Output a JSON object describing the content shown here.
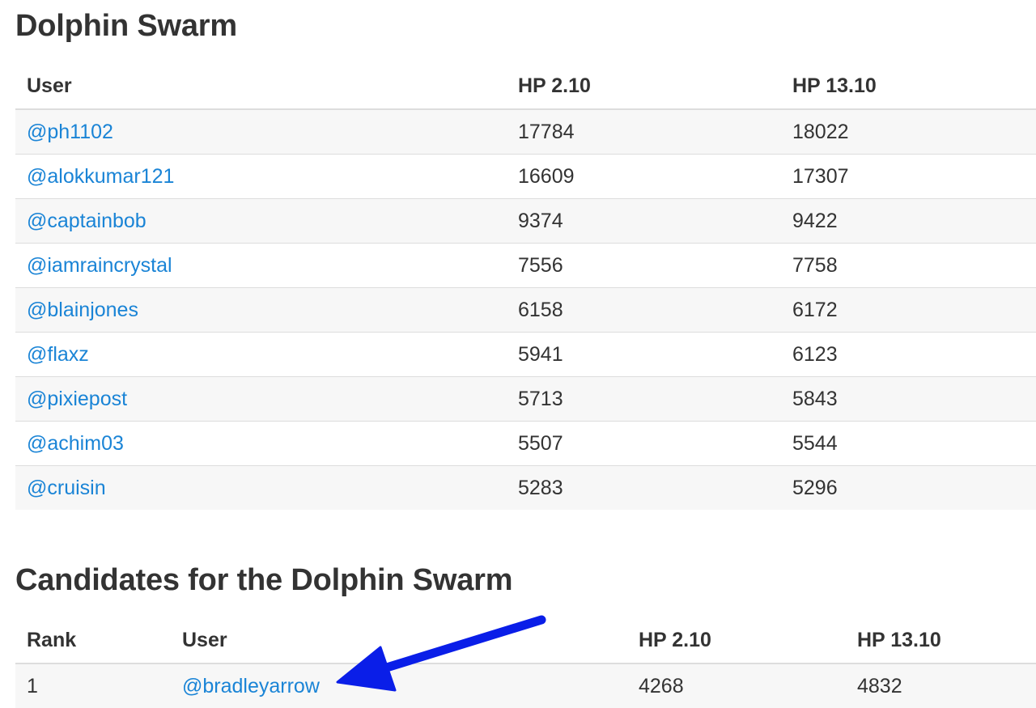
{
  "swarm": {
    "title": "Dolphin Swarm",
    "headers": [
      "User",
      "HP 2.10",
      "HP 13.10"
    ],
    "rows": [
      {
        "user": "@ph1102",
        "hp_2_10": "17784",
        "hp_13_10": "18022"
      },
      {
        "user": "@alokkumar121",
        "hp_2_10": "16609",
        "hp_13_10": "17307"
      },
      {
        "user": "@captainbob",
        "hp_2_10": "9374",
        "hp_13_10": "9422"
      },
      {
        "user": "@iamraincrystal",
        "hp_2_10": "7556",
        "hp_13_10": "7758"
      },
      {
        "user": "@blainjones",
        "hp_2_10": "6158",
        "hp_13_10": "6172"
      },
      {
        "user": "@flaxz",
        "hp_2_10": "5941",
        "hp_13_10": "6123"
      },
      {
        "user": "@pixiepost",
        "hp_2_10": "5713",
        "hp_13_10": "5843"
      },
      {
        "user": "@achim03",
        "hp_2_10": "5507",
        "hp_13_10": "5544"
      },
      {
        "user": "@cruisin",
        "hp_2_10": "5283",
        "hp_13_10": "5296"
      }
    ]
  },
  "candidates": {
    "title": "Candidates for the Dolphin Swarm",
    "headers": [
      "Rank",
      "User",
      "HP 2.10",
      "HP 13.10"
    ],
    "rows": [
      {
        "rank": "1",
        "user": "@bradleyarrow",
        "hp_2_10": "4268",
        "hp_13_10": "4832"
      }
    ]
  },
  "colors": {
    "link": "#1a84d6",
    "annotation_arrow": "#0a1ee8",
    "row_stripe": "#f7f7f7"
  },
  "icons": {
    "annotation": "arrow-pointer-icon"
  }
}
